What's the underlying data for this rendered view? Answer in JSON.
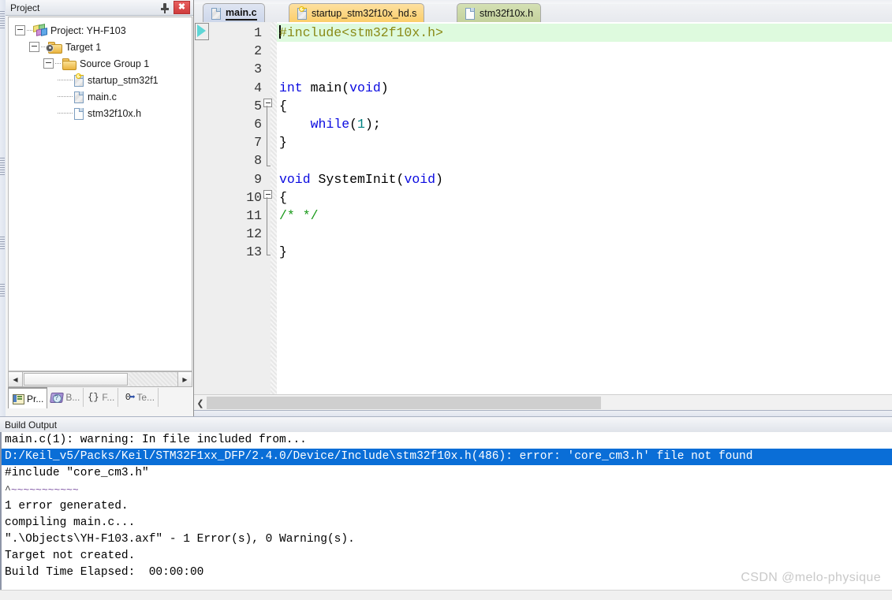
{
  "project_panel": {
    "title": "Project",
    "pin_tooltip": "Auto Hide",
    "close_label": "✖",
    "tree": [
      {
        "label": "Project: YH-F103",
        "icon": "project-icon",
        "depth": 0
      },
      {
        "label": "Target 1",
        "icon": "target-folder-icon",
        "depth": 1
      },
      {
        "label": "Source Group 1",
        "icon": "folder-icon",
        "depth": 2
      },
      {
        "label": "startup_stm32f1",
        "icon": "asm-file-icon",
        "depth": 3
      },
      {
        "label": "main.c",
        "icon": "c-file-icon",
        "depth": 3
      },
      {
        "label": "stm32f10x.h",
        "icon": "header-file-icon",
        "depth": 3
      }
    ],
    "bottom_tabs": [
      {
        "label": "Pr...",
        "icon": "project-tab-icon",
        "active": true
      },
      {
        "label": "B...",
        "icon": "books-tab-icon",
        "active": false
      },
      {
        "label": "F...",
        "icon": "functions-tab-icon",
        "active": false
      },
      {
        "label": "Te...",
        "icon": "templates-tab-icon",
        "active": false
      }
    ],
    "scroll_left_arrow": "◀",
    "scroll_right_arrow": "▶"
  },
  "editor": {
    "tabs": [
      {
        "label": "main.c",
        "style": "active",
        "icon": "c-file-icon"
      },
      {
        "label": "startup_stm32f10x_hd.s",
        "style": "asm",
        "icon": "asm-file-icon"
      },
      {
        "label": "stm32f10x.h",
        "style": "hdr",
        "icon": "header-file-icon"
      }
    ],
    "line_numbers": [
      "1",
      "2",
      "3",
      "4",
      "5",
      "6",
      "7",
      "8",
      "9",
      "10",
      "11",
      "12",
      "13"
    ],
    "code": [
      {
        "n": 1,
        "highlight": true,
        "tokens": [
          {
            "t": "caret",
            "v": ""
          },
          {
            "t": "inc",
            "v": "#include<stm32f10x.h>"
          }
        ]
      },
      {
        "n": 2,
        "highlight": false,
        "tokens": []
      },
      {
        "n": 3,
        "highlight": false,
        "tokens": []
      },
      {
        "n": 4,
        "highlight": false,
        "tokens": [
          {
            "t": "kw",
            "v": "int"
          },
          {
            "t": "plain",
            "v": " main("
          },
          {
            "t": "kw",
            "v": "void"
          },
          {
            "t": "plain",
            "v": ")"
          }
        ]
      },
      {
        "n": 5,
        "highlight": false,
        "tokens": [
          {
            "t": "plain",
            "v": "{"
          }
        ]
      },
      {
        "n": 6,
        "highlight": false,
        "tokens": [
          {
            "t": "plain",
            "v": "    "
          },
          {
            "t": "kw",
            "v": "while"
          },
          {
            "t": "plain",
            "v": "("
          },
          {
            "t": "num",
            "v": "1"
          },
          {
            "t": "plain",
            "v": ");"
          }
        ]
      },
      {
        "n": 7,
        "highlight": false,
        "tokens": [
          {
            "t": "plain",
            "v": "}"
          }
        ]
      },
      {
        "n": 8,
        "highlight": false,
        "tokens": []
      },
      {
        "n": 9,
        "highlight": false,
        "tokens": [
          {
            "t": "kw",
            "v": "void"
          },
          {
            "t": "plain",
            "v": " SystemInit("
          },
          {
            "t": "kw",
            "v": "void"
          },
          {
            "t": "plain",
            "v": ")"
          }
        ]
      },
      {
        "n": 10,
        "highlight": false,
        "tokens": [
          {
            "t": "plain",
            "v": "{"
          }
        ]
      },
      {
        "n": 11,
        "highlight": false,
        "tokens": [
          {
            "t": "cmt",
            "v": "/* */"
          }
        ]
      },
      {
        "n": 12,
        "highlight": false,
        "tokens": []
      },
      {
        "n": 13,
        "highlight": false,
        "tokens": [
          {
            "t": "plain",
            "v": "}"
          }
        ]
      }
    ],
    "scroll_left_arrow": "❮"
  },
  "build_output": {
    "title": "Build Output",
    "lines": [
      {
        "text": "main.c(1): warning: In file included from...",
        "selected": false,
        "squiggle": false
      },
      {
        "text": "D:/Keil_v5/Packs/Keil/STM32F1xx_DFP/2.4.0/Device/Include\\stm32f10x.h(486): error: 'core_cm3.h' file not found",
        "selected": true,
        "squiggle": false
      },
      {
        "text": "#include \"core_cm3.h\"",
        "selected": false,
        "squiggle": false
      },
      {
        "text": "         ^~~~~~~~~~~~",
        "selected": false,
        "squiggle": true
      },
      {
        "text": "1 error generated.",
        "selected": false,
        "squiggle": false
      },
      {
        "text": "compiling main.c...",
        "selected": false,
        "squiggle": false
      },
      {
        "text": "\".\\Objects\\YH-F103.axf\" - 1 Error(s), 0 Warning(s).",
        "selected": false,
        "squiggle": false
      },
      {
        "text": "Target not created.",
        "selected": false,
        "squiggle": false
      },
      {
        "text": "Build Time Elapsed:  00:00:00",
        "selected": false,
        "squiggle": false
      }
    ],
    "watermark": "CSDN @melo-physique"
  },
  "colors": {
    "selection_blue": "#0a6ed7",
    "highlight_green": "#defade",
    "keyword_blue": "#0a0ae0",
    "comment_green": "#1a9a1a",
    "include_olive": "#8a8a16",
    "number_teal": "#008080",
    "asm_tab": "#fbcd68",
    "header_tab": "#c3d19c",
    "active_tab": "#ccd6ea"
  }
}
